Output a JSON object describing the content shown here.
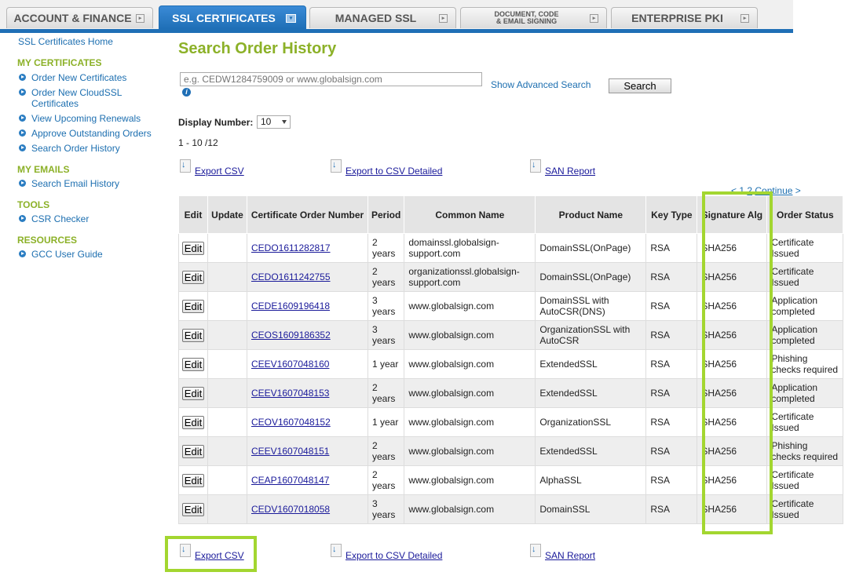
{
  "tabs": [
    {
      "label": "ACCOUNT & FINANCE"
    },
    {
      "label": "SSL CERTIFICATES"
    },
    {
      "label": "MANAGED SSL"
    },
    {
      "label_line1": "DOCUMENT, CODE",
      "label_line2": "& EMAIL SIGNING"
    },
    {
      "label": "ENTERPRISE PKI"
    }
  ],
  "sidebar": {
    "home": "SSL Certificates Home",
    "sections": [
      {
        "heading": "MY CERTIFICATES",
        "items": [
          "Order New Certificates",
          "Order New CloudSSL Certificates",
          "View Upcoming Renewals",
          "Approve Outstanding Orders",
          "Search Order History"
        ]
      },
      {
        "heading": "MY EMAILS",
        "items": [
          "Search Email History"
        ]
      },
      {
        "heading": "TOOLS",
        "items": [
          "CSR Checker"
        ]
      },
      {
        "heading": "RESOURCES",
        "items": [
          "GCC User Guide"
        ]
      }
    ]
  },
  "main": {
    "title": "Search Order History",
    "search_placeholder": "e.g. CEDW1284759009 or www.globalsign.com",
    "advanced_search": "Show Advanced Search",
    "search_button": "Search",
    "display_label": "Display Number:",
    "display_value": "10",
    "count": "1 - 10 /12",
    "export_csv": "Export CSV",
    "export_csv_detailed": "Export to CSV Detailed",
    "san_report": "SAN Report",
    "pager_prefix": "< 1",
    "pager_page2": "2",
    "pager_continue": "Continue",
    "pager_suffix": ">"
  },
  "table": {
    "headers": [
      "Edit",
      "Update",
      "Certificate Order Number",
      "Period",
      "Common Name",
      "Product Name",
      "Key Type",
      "Signature Alg",
      "Order Status"
    ],
    "edit_label": "Edit",
    "rows": [
      {
        "order": "CEDO1611282817",
        "period": "2 years",
        "common_name": "domainssl.globalsign-support.com",
        "product": "DomainSSL(OnPage)",
        "key": "RSA",
        "sig": "SHA256",
        "status": "Certificate Issued"
      },
      {
        "order": "CEDO1611242755",
        "period": "2 years",
        "common_name": "organizationssl.globalsign-support.com",
        "product": "DomainSSL(OnPage)",
        "key": "RSA",
        "sig": "SHA256",
        "status": "Certificate Issued"
      },
      {
        "order": "CEDE1609196418",
        "period": "3 years",
        "common_name": "www.globalsign.com",
        "product": "DomainSSL with AutoCSR(DNS)",
        "key": "RSA",
        "sig": "SHA256",
        "status": "Application completed"
      },
      {
        "order": "CEOS1609186352",
        "period": "3 years",
        "common_name": "www.globalsign.com",
        "product": "OrganizationSSL with AutoCSR",
        "key": "RSA",
        "sig": "SHA256",
        "status": "Application completed"
      },
      {
        "order": "CEEV1607048160",
        "period": "1 year",
        "common_name": "www.globalsign.com",
        "product": "ExtendedSSL",
        "key": "RSA",
        "sig": "SHA256",
        "status": "Phishing checks required"
      },
      {
        "order": "CEEV1607048153",
        "period": "2 years",
        "common_name": "www.globalsign.com",
        "product": "ExtendedSSL",
        "key": "RSA",
        "sig": "SHA256",
        "status": "Application completed"
      },
      {
        "order": "CEOV1607048152",
        "period": "1 year",
        "common_name": "www.globalsign.com",
        "product": "OrganizationSSL",
        "key": "RSA",
        "sig": "SHA256",
        "status": "Certificate Issued"
      },
      {
        "order": "CEEV1607048151",
        "period": "2 years",
        "common_name": "www.globalsign.com",
        "product": "ExtendedSSL",
        "key": "RSA",
        "sig": "SHA256",
        "status": "Phishing checks required"
      },
      {
        "order": "CEAP1607048147",
        "period": "2 years",
        "common_name": "www.globalsign.com",
        "product": "AlphaSSL",
        "key": "RSA",
        "sig": "SHA256",
        "status": "Certificate Issued"
      },
      {
        "order": "CEDV1607018058",
        "period": "3 years",
        "common_name": "www.globalsign.com",
        "product": "DomainSSL",
        "key": "RSA",
        "sig": "SHA256",
        "status": "Certificate Issued"
      }
    ]
  },
  "colors": {
    "brand_blue": "#1f6fb6",
    "title_green": "#8cb128",
    "highlight": "#a3d630"
  }
}
